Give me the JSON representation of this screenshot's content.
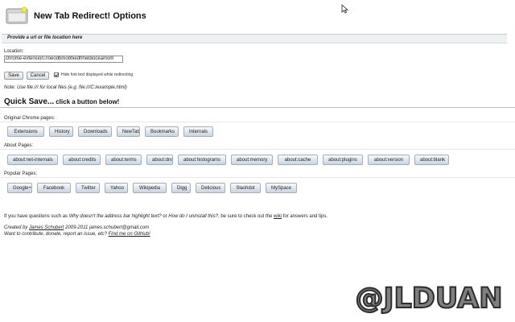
{
  "header": {
    "title": "New Tab Redirect! Options",
    "logo_icon": "folder-icon"
  },
  "section": {
    "title": "Provide a url or file location here"
  },
  "form": {
    "location_label": "Location:",
    "location_value": "chrome-extension://oeodbmobfiiedhheldioceamom",
    "save_label": "Save",
    "cancel_label": "Cancel",
    "hide_hint_checked": true,
    "hide_hint_label": "Hide hint text displayed while redirecting",
    "note": "Note: Use file:/// for local files (e.g. file:///C:/example.html)"
  },
  "quick_save": {
    "title": "Quick Save...",
    "subtitle": "click a button below!",
    "groups": [
      {
        "label": "Original Chrome pages:",
        "buttons": [
          "Extensions",
          "History",
          "Downloads",
          "NewTab",
          "Bookmarks",
          "Internals"
        ]
      },
      {
        "label": "About Pages:",
        "buttons": [
          "about:net-internals",
          "about:credits",
          "about:terms",
          "about:dns",
          "about:histograms",
          "about:memory",
          "about:cache",
          "about:plugins",
          "about:version",
          "about:blank"
        ]
      },
      {
        "label": "Popular Pages:",
        "buttons": [
          "Google+",
          "Facebook",
          "Twitter",
          "Yahoo",
          "Wikipedia",
          "Digg",
          "Delicious",
          "Slashdot",
          "MySpace"
        ]
      }
    ]
  },
  "help": {
    "prefix": "If you have questions such as ",
    "question1": "Why doesn't the address bar highlight text?",
    "middle": " or ",
    "question2": "How do I uninstall this?",
    "after": ", be sure to check out the ",
    "wiki_link": "wiki",
    "suffix": " for answers and tips."
  },
  "credits": {
    "created_prefix": "Created by ",
    "author": "James Schubert",
    "years": " 2009-2011",
    "email": " james.schubert@gmail.com",
    "contribute_text": "Want to contribute, donate, report an issue, etc? ",
    "github_link": "Find me on GitHub!"
  },
  "watermark": {
    "text": "@JLDUAN"
  }
}
